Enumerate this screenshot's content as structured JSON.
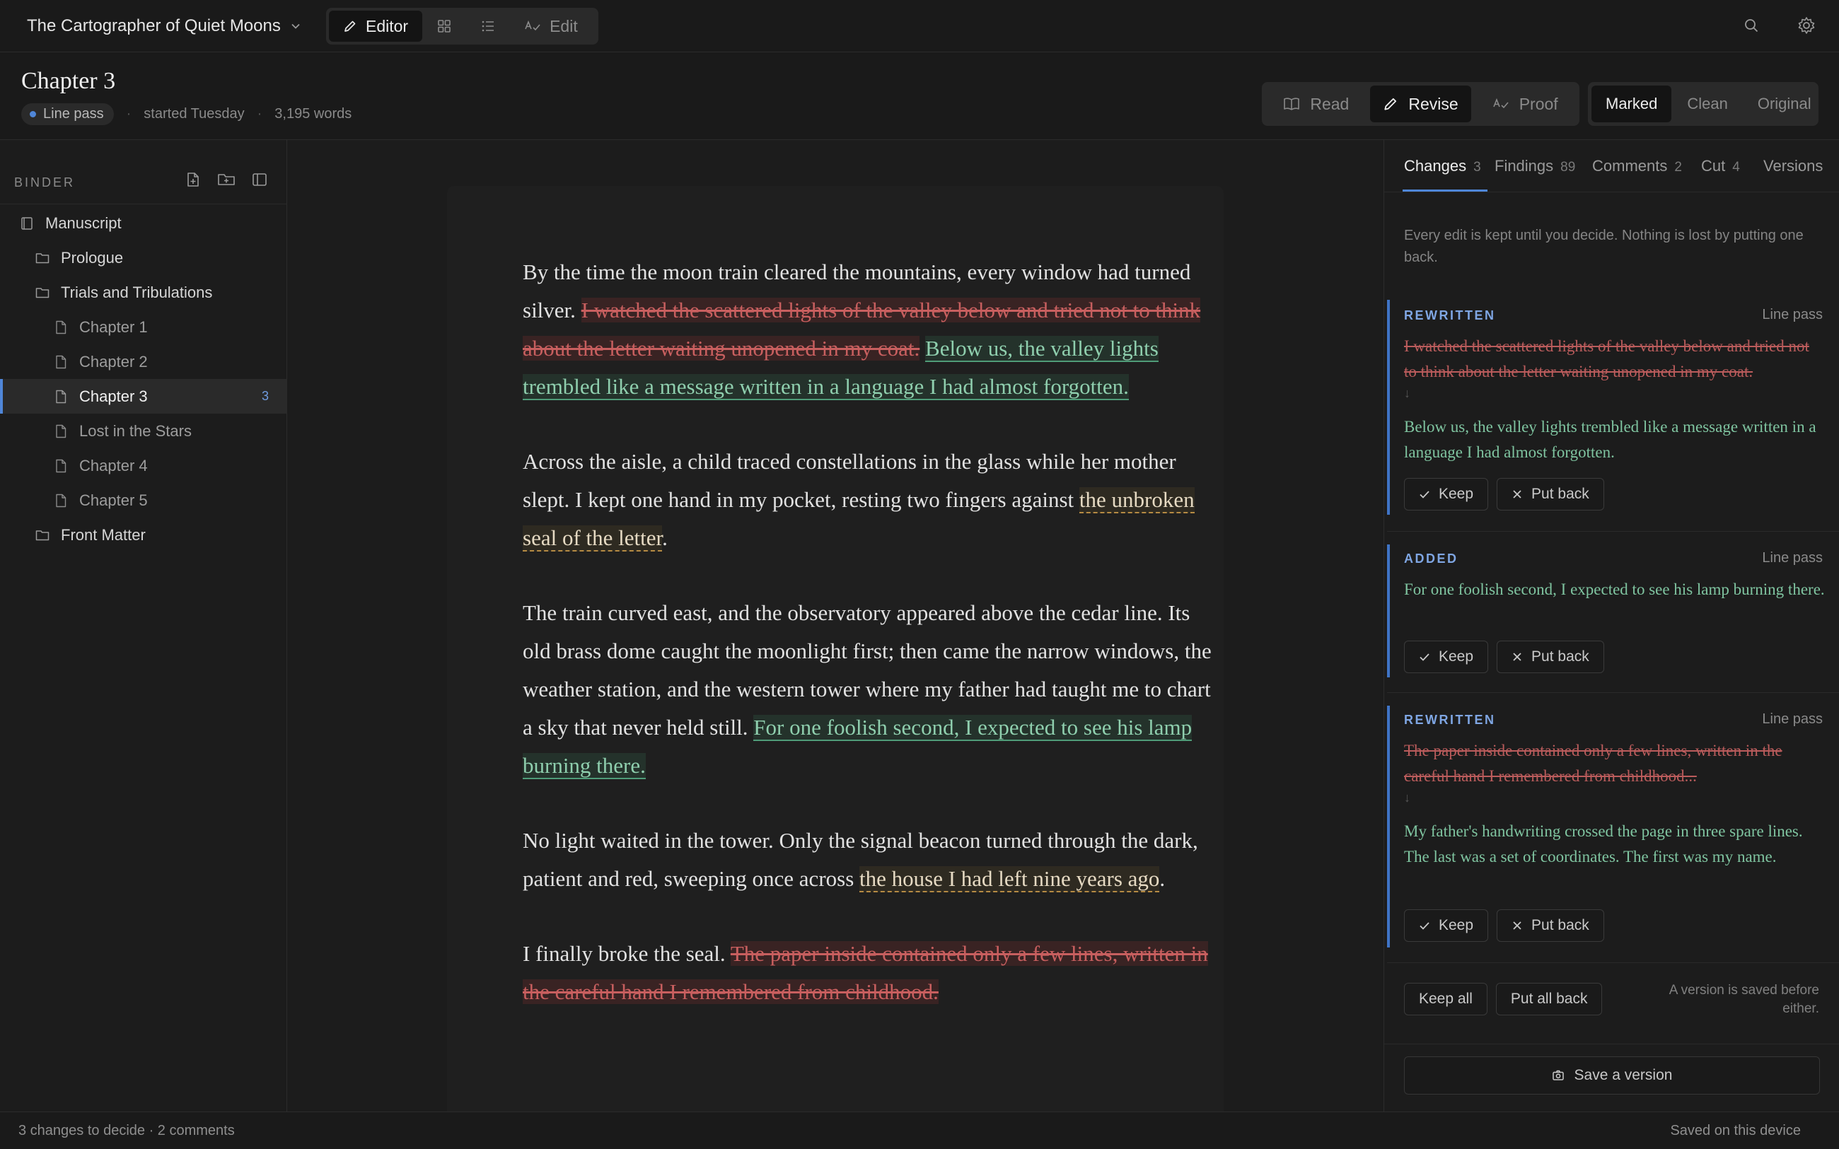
{
  "project": {
    "title": "The Cartographer of Quiet Moons",
    "icon": "chevron-down-icon"
  },
  "modes": [
    {
      "label": "Editor",
      "icon": "pencil-icon",
      "active": true
    },
    {
      "label": "",
      "icon": "grid-icon"
    },
    {
      "label": "",
      "icon": "list-icon"
    },
    {
      "label": "Edit",
      "icon": "spellcheck-icon"
    }
  ],
  "doc": {
    "title": "Chapter 3",
    "pass": "Line pass",
    "started": "started Tuesday",
    "words": "3,195 words"
  },
  "view_tabs": [
    {
      "label": "Read",
      "icon": "book-icon"
    },
    {
      "label": "Revise",
      "icon": "pencil-icon",
      "active": true
    },
    {
      "label": "Proof",
      "icon": "spellcheck-icon"
    }
  ],
  "markup_tabs": [
    {
      "label": "Marked",
      "active": true
    },
    {
      "label": "Clean"
    },
    {
      "label": "Original"
    }
  ],
  "binder": {
    "heading": "BINDER",
    "items": [
      {
        "label": "Manuscript",
        "kind": "book"
      },
      {
        "label": "Prologue",
        "kind": "folder"
      },
      {
        "label": "Trials and Tribulations",
        "kind": "folder"
      },
      {
        "label": "Chapter 1",
        "kind": "doc"
      },
      {
        "label": "Chapter 2",
        "kind": "doc"
      },
      {
        "label": "Chapter 3",
        "kind": "doc",
        "active": true,
        "count": "3"
      },
      {
        "label": "Lost in the Stars",
        "kind": "doc"
      },
      {
        "label": "Chapter 4",
        "kind": "doc"
      },
      {
        "label": "Chapter 5",
        "kind": "doc"
      },
      {
        "label": "Front Matter",
        "kind": "folder"
      }
    ]
  },
  "prose": {
    "p1_a": "By the time the moon train cleared the mountains, every window had turned silver. ",
    "p1_del": "I watched the scattered lights of the valley below and tried not to think about the letter waiting unopened in my coat.",
    "p1_ins": "Below us, the valley lights trembled like a message written in a language I had almost forgotten.",
    "p2_a": "Across the aisle, a child traced constellations in the glass while her mother slept. I kept one hand in my pocket, resting two fingers against ",
    "p2_note": "the unbroken seal of the letter",
    "p2_b": ".",
    "p3_a": "The train curved east, and the observatory appeared above the cedar line. Its old brass dome caught the moonlight first; then came the narrow windows, the weather station, and the western tower where my father had taught me to chart a sky that never held still. ",
    "p3_ins": "For one foolish second, I expected to see his lamp burning there.",
    "p4_a": "No light waited in the tower. Only the signal beacon turned through the dark, patient and red, sweeping once across ",
    "p4_note": "the house I had left nine years ago",
    "p4_b": ".",
    "p5_a": "I finally broke the seal. ",
    "p5_del": "The paper inside contained only a few lines, written in the careful hand I remembered from childhood."
  },
  "panel": {
    "tabs": [
      {
        "label": "Changes",
        "count": "3",
        "active": true
      },
      {
        "label": "Findings",
        "count": "89"
      },
      {
        "label": "Comments",
        "count": "2"
      },
      {
        "label": "Cut",
        "count": "4"
      },
      {
        "label": "Versions",
        "count": ""
      }
    ],
    "intro": "Every edit is kept until you decide. Nothing is lost by putting one back.",
    "cards": [
      {
        "type": "REWRITTEN",
        "pass": "Line pass",
        "old": "I watched the scattered lights of the valley below and tried not to think about the letter waiting unopened in my coat.",
        "arrow": "↓",
        "new": "Below us, the valley lights trembled like a message written in a language I had almost forgotten.",
        "keep": "Keep",
        "put_back": "Put back"
      },
      {
        "type": "ADDED",
        "pass": "Line pass",
        "new": "For one foolish second, I expected to see his lamp burning there.",
        "keep": "Keep",
        "put_back": "Put back"
      },
      {
        "type": "REWRITTEN",
        "pass": "Line pass",
        "old": "The paper inside contained only a few lines, written in the careful hand I remembered from childhood...",
        "arrow": "↓",
        "new": "My father's handwriting crossed the page in three spare lines. The last was a set of coordinates. The first was my name.",
        "keep": "Keep",
        "put_back": "Put back"
      }
    ],
    "keep_all": "Keep all",
    "put_all_back": "Put all back",
    "saved_note": "A version is saved before either.",
    "save_version": "Save a version"
  },
  "status": {
    "left": "3 changes to decide · 2 comments",
    "right": "Saved on this device"
  }
}
